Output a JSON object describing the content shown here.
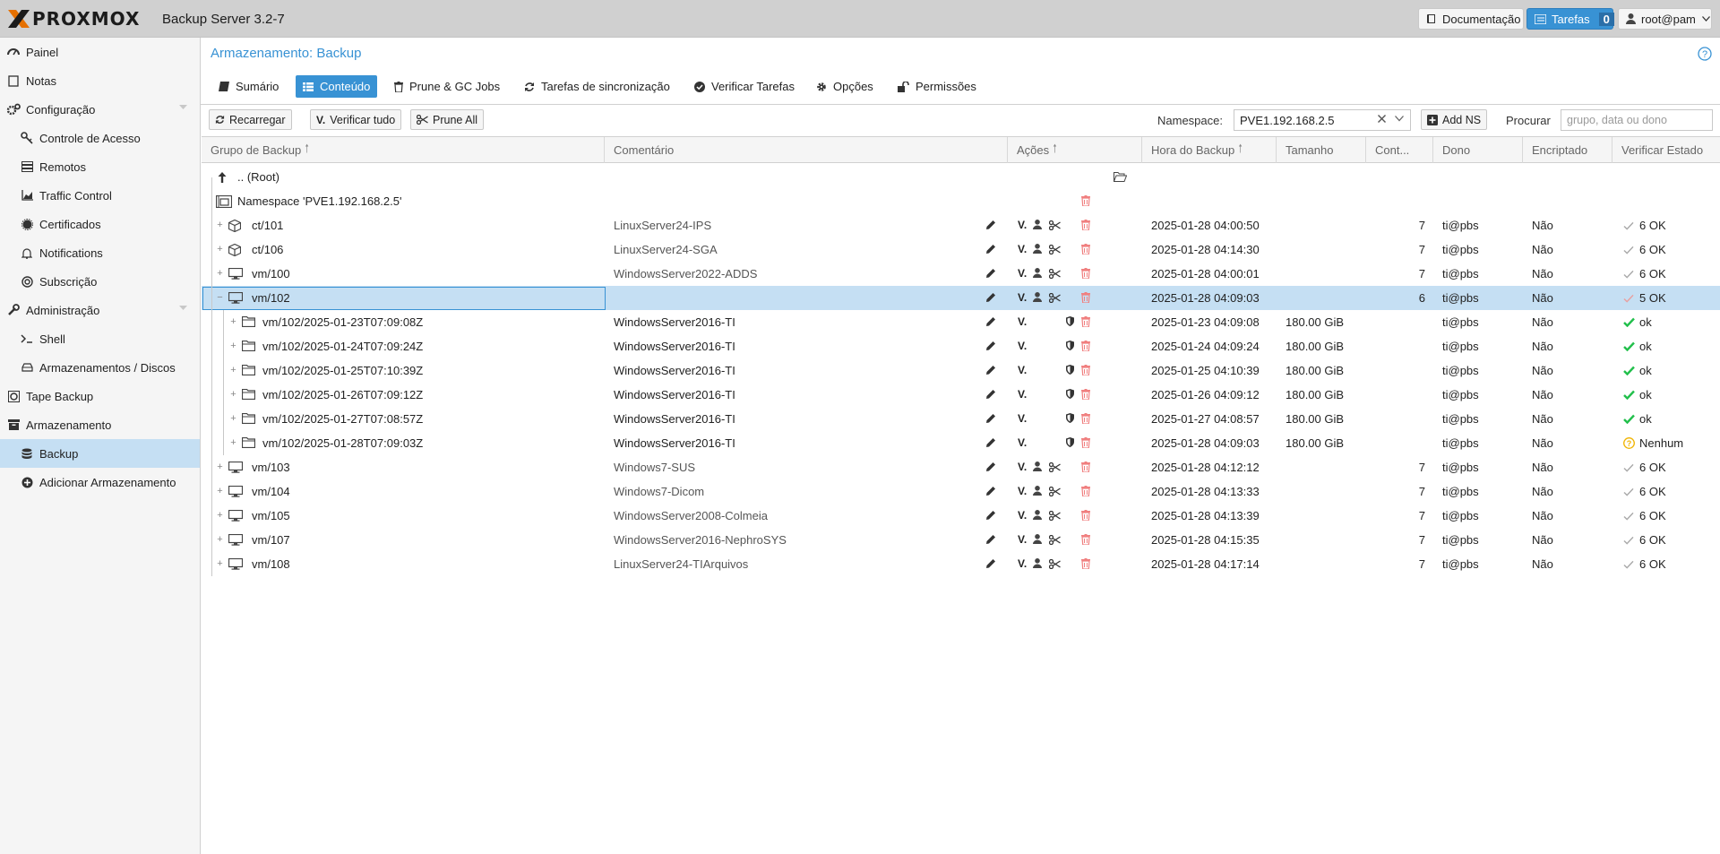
{
  "header": {
    "brand": "PROXMOX",
    "product": "Backup Server 3.2-7",
    "docs_label": "Documentação",
    "tasks_label": "Tarefas",
    "tasks_count": "0",
    "user": "root@pam"
  },
  "sidebar": {
    "items": [
      {
        "label": "Painel"
      },
      {
        "label": "Notas"
      },
      {
        "label": "Configuração"
      },
      {
        "label": "Controle de Acesso"
      },
      {
        "label": "Remotos"
      },
      {
        "label": "Traffic Control"
      },
      {
        "label": "Certificados"
      },
      {
        "label": "Notifications"
      },
      {
        "label": "Subscrição"
      },
      {
        "label": "Administração"
      },
      {
        "label": "Shell"
      },
      {
        "label": "Armazenamentos / Discos"
      },
      {
        "label": "Tape Backup"
      },
      {
        "label": "Armazenamento"
      },
      {
        "label": "Backup"
      },
      {
        "label": "Adicionar Armazenamento"
      }
    ]
  },
  "main": {
    "title": "Armazenamento: Backup",
    "tabs": [
      {
        "label": "Sumário"
      },
      {
        "label": "Conteúdo"
      },
      {
        "label": "Prune & GC Jobs"
      },
      {
        "label": "Tarefas de sincronização"
      },
      {
        "label": "Verificar Tarefas"
      },
      {
        "label": "Opções"
      },
      {
        "label": "Permissões"
      }
    ],
    "toolbar": {
      "reload": "Recarregar",
      "verify_all": "Verificar tudo",
      "prune_all": "Prune All",
      "namespace_label": "Namespace:",
      "namespace_value": "PVE1.192.168.2.5",
      "add_ns": "Add NS",
      "search_label": "Procurar",
      "search_placeholder": "grupo, data ou dono"
    },
    "columns": [
      "Grupo de Backup",
      "Comentário",
      "Ações",
      "Hora do Backup",
      "Tamanho",
      "Cont...",
      "Dono",
      "Encriptado",
      "Verificar Estado"
    ],
    "rows": [
      {
        "name": ".. (Root)",
        "comment": "",
        "time": "",
        "size": "",
        "count": "",
        "owner": "",
        "encrypted": "",
        "verify": ""
      },
      {
        "name": "Namespace 'PVE1.192.168.2.5'",
        "comment": "",
        "time": "",
        "size": "",
        "count": "",
        "owner": "",
        "encrypted": "",
        "verify": ""
      },
      {
        "name": "ct/101",
        "comment": "LinuxServer24-IPS",
        "time": "2025-01-28 04:00:50",
        "size": "",
        "count": "7",
        "owner": "ti@pbs",
        "encrypted": "Não",
        "verify": "6 OK"
      },
      {
        "name": "ct/106",
        "comment": "LinuxServer24-SGA",
        "time": "2025-01-28 04:14:30",
        "size": "",
        "count": "7",
        "owner": "ti@pbs",
        "encrypted": "Não",
        "verify": "6 OK"
      },
      {
        "name": "vm/100",
        "comment": "WindowsServer2022-ADDS",
        "time": "2025-01-28 04:00:01",
        "size": "",
        "count": "7",
        "owner": "ti@pbs",
        "encrypted": "Não",
        "verify": "6 OK"
      },
      {
        "name": "vm/102",
        "comment": "",
        "time": "2025-01-28 04:09:03",
        "size": "",
        "count": "6",
        "owner": "ti@pbs",
        "encrypted": "Não",
        "verify": "5 OK"
      },
      {
        "name": "vm/102/2025-01-23T07:09:08Z",
        "comment": "WindowsServer2016-TI",
        "time": "2025-01-23 04:09:08",
        "size": "180.00 GiB",
        "count": "",
        "owner": "ti@pbs",
        "encrypted": "Não",
        "verify": "ok"
      },
      {
        "name": "vm/102/2025-01-24T07:09:24Z",
        "comment": "WindowsServer2016-TI",
        "time": "2025-01-24 04:09:24",
        "size": "180.00 GiB",
        "count": "",
        "owner": "ti@pbs",
        "encrypted": "Não",
        "verify": "ok"
      },
      {
        "name": "vm/102/2025-01-25T07:10:39Z",
        "comment": "WindowsServer2016-TI",
        "time": "2025-01-25 04:10:39",
        "size": "180.00 GiB",
        "count": "",
        "owner": "ti@pbs",
        "encrypted": "Não",
        "verify": "ok"
      },
      {
        "name": "vm/102/2025-01-26T07:09:12Z",
        "comment": "WindowsServer2016-TI",
        "time": "2025-01-26 04:09:12",
        "size": "180.00 GiB",
        "count": "",
        "owner": "ti@pbs",
        "encrypted": "Não",
        "verify": "ok"
      },
      {
        "name": "vm/102/2025-01-27T07:08:57Z",
        "comment": "WindowsServer2016-TI",
        "time": "2025-01-27 04:08:57",
        "size": "180.00 GiB",
        "count": "",
        "owner": "ti@pbs",
        "encrypted": "Não",
        "verify": "ok"
      },
      {
        "name": "vm/102/2025-01-28T07:09:03Z",
        "comment": "WindowsServer2016-TI",
        "time": "2025-01-28 04:09:03",
        "size": "180.00 GiB",
        "count": "",
        "owner": "ti@pbs",
        "encrypted": "Não",
        "verify": "Nenhum"
      },
      {
        "name": "vm/103",
        "comment": "Windows7-SUS",
        "time": "2025-01-28 04:12:12",
        "size": "",
        "count": "7",
        "owner": "ti@pbs",
        "encrypted": "Não",
        "verify": "6 OK"
      },
      {
        "name": "vm/104",
        "comment": "Windows7-Dicom",
        "time": "2025-01-28 04:13:33",
        "size": "",
        "count": "7",
        "owner": "ti@pbs",
        "encrypted": "Não",
        "verify": "6 OK"
      },
      {
        "name": "vm/105",
        "comment": "WindowsServer2008-Colmeia",
        "time": "2025-01-28 04:13:39",
        "size": "",
        "count": "7",
        "owner": "ti@pbs",
        "encrypted": "Não",
        "verify": "6 OK"
      },
      {
        "name": "vm/107",
        "comment": "WindowsServer2016-NephroSYS",
        "time": "2025-01-28 04:15:35",
        "size": "",
        "count": "7",
        "owner": "ti@pbs",
        "encrypted": "Não",
        "verify": "6 OK"
      },
      {
        "name": "vm/108",
        "comment": "LinuxServer24-TIArquivos",
        "time": "2025-01-28 04:17:14",
        "size": "",
        "count": "7",
        "owner": "ti@pbs",
        "encrypted": "Não",
        "verify": "6 OK"
      }
    ]
  },
  "colors": {
    "accent": "#3892d4",
    "selection": "#c5dff3",
    "ok_green": "#21bf4b",
    "danger": "#f08080",
    "warning": "#f0b400"
  }
}
